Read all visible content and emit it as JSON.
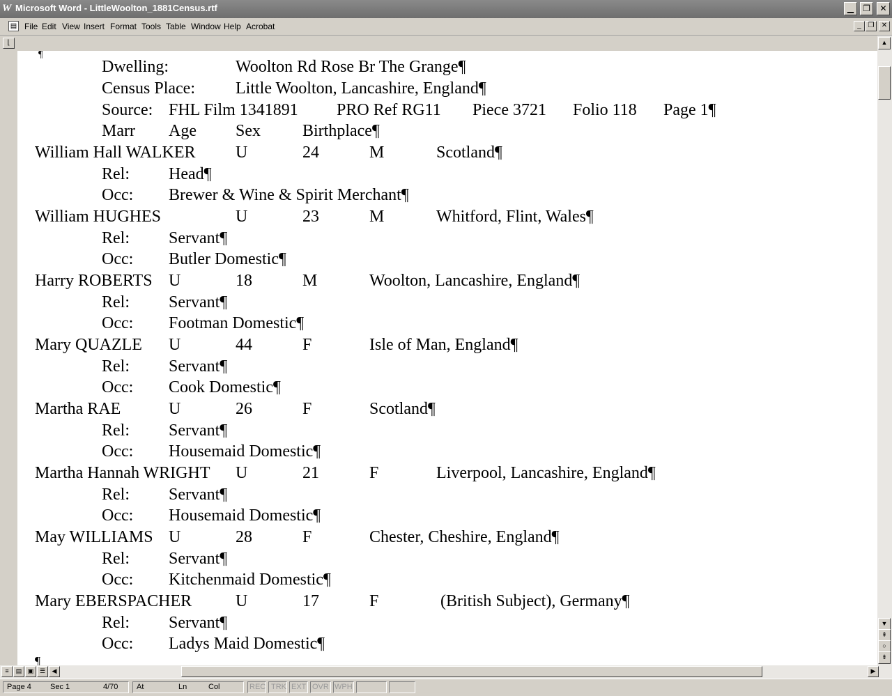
{
  "window": {
    "title": "Microsoft Word - LittleWoolton_1881Census.rtf",
    "app_icon": "W"
  },
  "menu": [
    "File",
    "Edit",
    "View",
    "Insert",
    "Format",
    "Tools",
    "Table",
    "Window",
    "Help",
    "Acrobat"
  ],
  "document": {
    "top_mark": "¶",
    "header": {
      "dwelling_label": "Dwelling:",
      "dwelling_value": "Woolton Rd Rose Br The Grange¶",
      "census_label": "Census Place:",
      "census_value": "Little Woolton, Lancashire, England¶",
      "source_label": "Source:",
      "source_film": "FHL Film 1341891",
      "source_pro": "PRO Ref RG11",
      "source_piece": "Piece 3721",
      "source_folio": "Folio 118",
      "source_page": "Page 1¶",
      "col_marr": "Marr",
      "col_age": "Age",
      "col_sex": "Sex",
      "col_birthplace": "Birthplace¶"
    },
    "persons": [
      {
        "name": "William Hall WALKER",
        "marr": "U",
        "age": "24",
        "sex": "M",
        "birthplace": "Scotland¶",
        "rel_label": "Rel:",
        "rel": "Head¶",
        "occ_label": "Occ:",
        "occ": "Brewer & Wine & Spirit Merchant¶"
      },
      {
        "name": "William HUGHES",
        "marr": "U",
        "age": "23",
        "sex": "M",
        "birthplace": "Whitford, Flint, Wales¶",
        "rel_label": "Rel:",
        "rel": "Servant¶",
        "occ_label": "Occ:",
        "occ": "Butler Domestic¶"
      },
      {
        "name": "Harry ROBERTS",
        "marr": "U",
        "age": "18",
        "sex": "M",
        "birthplace": "Woolton, Lancashire, England¶",
        "rel_label": "Rel:",
        "rel": "Servant¶",
        "occ_label": "Occ:",
        "occ": "Footman Domestic¶"
      },
      {
        "name": "Mary QUAZLE",
        "marr": "U",
        "age": "44",
        "sex": "F",
        "birthplace": "Isle of Man, England¶",
        "rel_label": "Rel:",
        "rel": "Servant¶",
        "occ_label": "Occ:",
        "occ": "Cook Domestic¶"
      },
      {
        "name": "Martha RAE",
        "marr": "U",
        "age": "26",
        "sex": "F",
        "birthplace": "Scotland¶",
        "rel_label": "Rel:",
        "rel": "Servant¶",
        "occ_label": "Occ:",
        "occ": "Housemaid Domestic¶"
      },
      {
        "name": "Martha Hannah WRIGHT",
        "marr": "U",
        "age": "21",
        "sex": "F",
        "birthplace": "Liverpool, Lancashire, England¶",
        "rel_label": "Rel:",
        "rel": "Servant¶",
        "occ_label": "Occ:",
        "occ": "Housemaid Domestic¶"
      },
      {
        "name": "May WILLIAMS",
        "marr": "U",
        "age": "28",
        "sex": "F",
        "birthplace": "Chester, Cheshire, England¶",
        "rel_label": "Rel:",
        "rel": "Servant¶",
        "occ_label": "Occ:",
        "occ": "Kitchenmaid Domestic¶"
      },
      {
        "name": "Mary EBERSPACHER",
        "marr": "U",
        "age": "17",
        "sex": "F",
        "birthplace": "(British Subject), Germany¶",
        "rel_label": "Rel:",
        "rel": "Servant¶",
        "occ_label": "Occ:",
        "occ": "Ladys Maid Domestic¶"
      }
    ],
    "end_mark": "¶"
  },
  "status": {
    "page": "Page 4",
    "sec": "Sec 1",
    "pages": "4/70",
    "at": "At",
    "ln": "Ln",
    "col": "Col",
    "rec": "REC",
    "trk": "TRK",
    "ext": "EXT",
    "ovr": "OVR",
    "wph": "WPH"
  }
}
